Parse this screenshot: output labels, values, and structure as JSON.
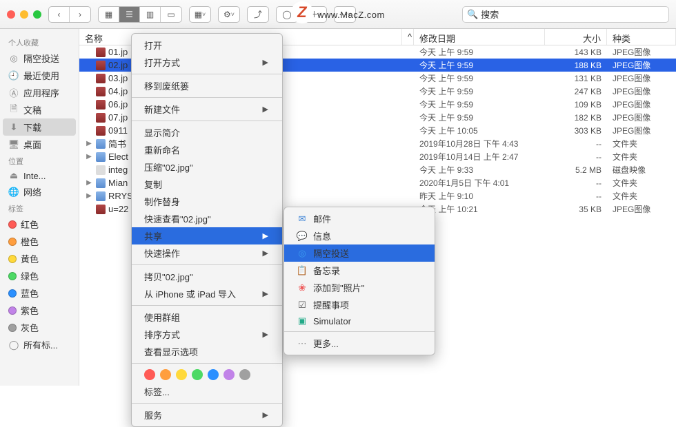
{
  "watermark": "www.MacZ.com",
  "toolbar": {
    "search_placeholder": "搜索"
  },
  "sidebar": {
    "favorites_label": "个人收藏",
    "favorites": [
      "隔空投送",
      "最近使用",
      "应用程序",
      "文稿",
      "下载",
      "桌面"
    ],
    "locations_label": "位置",
    "locations": [
      "Inte...",
      "网络"
    ],
    "tags_label": "标签",
    "tags": [
      {
        "label": "红色",
        "color": "#ff5b56"
      },
      {
        "label": "橙色",
        "color": "#ff9e3e"
      },
      {
        "label": "黄色",
        "color": "#ffd93b"
      },
      {
        "label": "绿色",
        "color": "#4cd964"
      },
      {
        "label": "蓝色",
        "color": "#2b90ff"
      },
      {
        "label": "紫色",
        "color": "#c183e8"
      },
      {
        "label": "灰色",
        "color": "#a0a0a0"
      },
      {
        "label": "所有标..."
      }
    ]
  },
  "cols": {
    "name": "名称",
    "date": "修改日期",
    "size": "大小",
    "kind": "种类"
  },
  "files": [
    {
      "name": "01.jp",
      "date": "今天 上午 9:59",
      "size": "143 KB",
      "kind": "JPEG图像",
      "t": "img"
    },
    {
      "name": "02.jp",
      "date": "今天 上午 9:59",
      "size": "188 KB",
      "kind": "JPEG图像",
      "t": "img",
      "sel": true
    },
    {
      "name": "03.jp",
      "date": "今天 上午 9:59",
      "size": "131 KB",
      "kind": "JPEG图像",
      "t": "img"
    },
    {
      "name": "04.jp",
      "date": "今天 上午 9:59",
      "size": "247 KB",
      "kind": "JPEG图像",
      "t": "img"
    },
    {
      "name": "06.jp",
      "date": "今天 上午 9:59",
      "size": "109 KB",
      "kind": "JPEG图像",
      "t": "img"
    },
    {
      "name": "07.jp",
      "date": "今天 上午 9:59",
      "size": "182 KB",
      "kind": "JPEG图像",
      "t": "img"
    },
    {
      "name": "0911",
      "date": "今天 上午 10:05",
      "size": "303 KB",
      "kind": "JPEG图像",
      "t": "img"
    },
    {
      "name": "简书",
      "date": "2019年10月28日 下午 4:43",
      "size": "--",
      "kind": "文件夹",
      "t": "fld",
      "exp": true
    },
    {
      "name": "Elect",
      "date": "2019年10月14日 上午 2:47",
      "size": "--",
      "kind": "文件夹",
      "t": "fld",
      "exp": true
    },
    {
      "name": "integ",
      "date": "今天 上午 9:33",
      "size": "5.2 MB",
      "kind": "磁盘映像",
      "t": "dmg"
    },
    {
      "name": "Mian",
      "date": "2020年1月5日 下午 4:01",
      "size": "--",
      "kind": "文件夹",
      "t": "fld",
      "exp": true
    },
    {
      "name": "RRYS",
      "date": "昨天 上午 9:10",
      "size": "--",
      "kind": "文件夹",
      "t": "fld",
      "exp": true
    },
    {
      "name": "u=22",
      "date": "今天 上午 10:21",
      "size": "35 KB",
      "kind": "JPEG图像",
      "t": "img"
    }
  ],
  "menu": {
    "items": [
      {
        "label": "打开"
      },
      {
        "label": "打开方式",
        "sub": true
      },
      {
        "sep": true
      },
      {
        "label": "移到废纸篓"
      },
      {
        "sep": true
      },
      {
        "label": "新建文件",
        "sub": true
      },
      {
        "sep": true
      },
      {
        "label": "显示简介"
      },
      {
        "label": "重新命名"
      },
      {
        "label": "压缩\"02.jpg\""
      },
      {
        "label": "复制"
      },
      {
        "label": "制作替身"
      },
      {
        "label": "快速查看\"02.jpg\""
      },
      {
        "label": "共享",
        "sub": true,
        "sel": true
      },
      {
        "label": "快速操作",
        "sub": true
      },
      {
        "sep": true
      },
      {
        "label": "拷贝\"02.jpg\""
      },
      {
        "label": "从 iPhone 或 iPad 导入",
        "sub": true
      },
      {
        "sep": true
      },
      {
        "label": "使用群组"
      },
      {
        "label": "排序方式",
        "sub": true
      },
      {
        "label": "查看显示选项"
      },
      {
        "sep": true
      },
      {
        "tags": true
      },
      {
        "label": "标签...",
        "indent": true
      },
      {
        "sep": true
      },
      {
        "label": "服务",
        "sub": true
      }
    ],
    "tagcolors": [
      "#ff5b56",
      "#ff9e3e",
      "#ffd93b",
      "#4cd964",
      "#2b90ff",
      "#c183e8",
      "#a0a0a0"
    ]
  },
  "submenu": {
    "items": [
      {
        "label": "邮件",
        "ico": "✉︎",
        "c": "#3b82d6"
      },
      {
        "label": "信息",
        "ico": "💬",
        "c": "#4cd964"
      },
      {
        "label": "隔空投送",
        "ico": "◎",
        "c": "#3b9cf0",
        "sel": true
      },
      {
        "label": "备忘录",
        "ico": "📋",
        "c": "#f0c94a"
      },
      {
        "label": "添加到\"照片\"",
        "ico": "❀",
        "c": "#e55"
      },
      {
        "label": "提醒事项",
        "ico": "☑︎",
        "c": "#555"
      },
      {
        "label": "Simulator",
        "ico": "▣",
        "c": "#2a8"
      },
      {
        "sep": true
      },
      {
        "label": "更多...",
        "ico": "⋯",
        "c": "#888"
      }
    ]
  }
}
